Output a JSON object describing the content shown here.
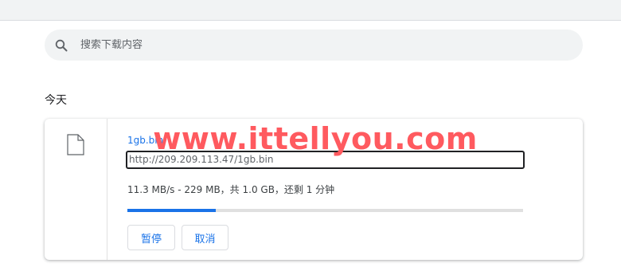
{
  "search": {
    "placeholder": "搜索下载内容"
  },
  "section": {
    "date": "今天"
  },
  "download": {
    "file_name": "1gb.bin",
    "url": "http://209.209.113.47/1gb.bin",
    "status": "11.3 MB/s - 229 MB，共 1.0 GB，还剩 1 分钟",
    "progress_fraction": 0.2236,
    "buttons": {
      "pause": "暂停",
      "cancel": "取消"
    }
  },
  "watermark": "www.ittellyou.com",
  "colors": {
    "accent": "#1a73e8",
    "watermark": "#ff5a5f"
  },
  "icons": {
    "search": "search-icon",
    "file": "file-icon"
  }
}
